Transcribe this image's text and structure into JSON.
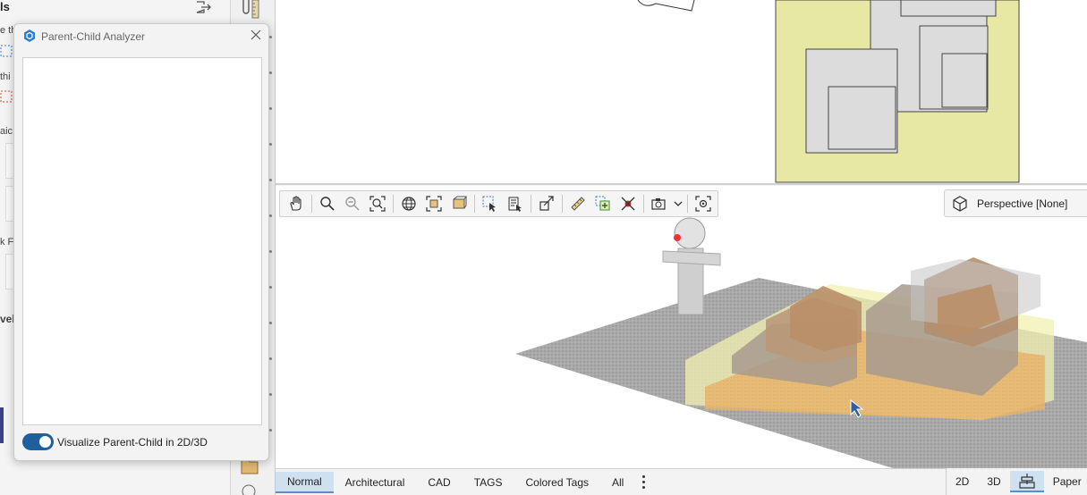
{
  "left_panel": {
    "title_fragment": "ls",
    "text_fragments": [
      "e th",
      "thi",
      "aic",
      "k Fl",
      "velo"
    ]
  },
  "dialog": {
    "title": "Parent-Child Analyzer",
    "toggle_label": "Visualize Parent-Child in 2D/3D",
    "toggle_on": true
  },
  "view3d": {
    "perspective_label": "Perspective [None]",
    "toolbar_icons": [
      "pan-hand-icon",
      "zoom-icon",
      "zoom-minus-icon",
      "zoom-fit-icon",
      "orbit-globe-icon",
      "fit-selection-icon",
      "walk-view-icon",
      "select-arrow-icon",
      "select-list-icon",
      "crop-icon",
      "measure-ruler-icon",
      "copy-add-icon",
      "clear-x-icon",
      "camera-icon",
      "camera-dropdown-icon",
      "focus-target-icon"
    ]
  },
  "bottom_tabs": {
    "tabs": [
      "Normal",
      "Architectural",
      "CAD",
      "TAGS",
      "Colored Tags",
      "All"
    ],
    "active": "Normal",
    "view_buttons": [
      "2D",
      "3D",
      "Paper"
    ]
  },
  "colors": {
    "accent": "#1f5f9e",
    "active_tab_bg": "#cfe0f0",
    "site_yellow": "#e6e8a3",
    "ground_gray": "#a8a8a8",
    "wood": "#c8955e"
  }
}
